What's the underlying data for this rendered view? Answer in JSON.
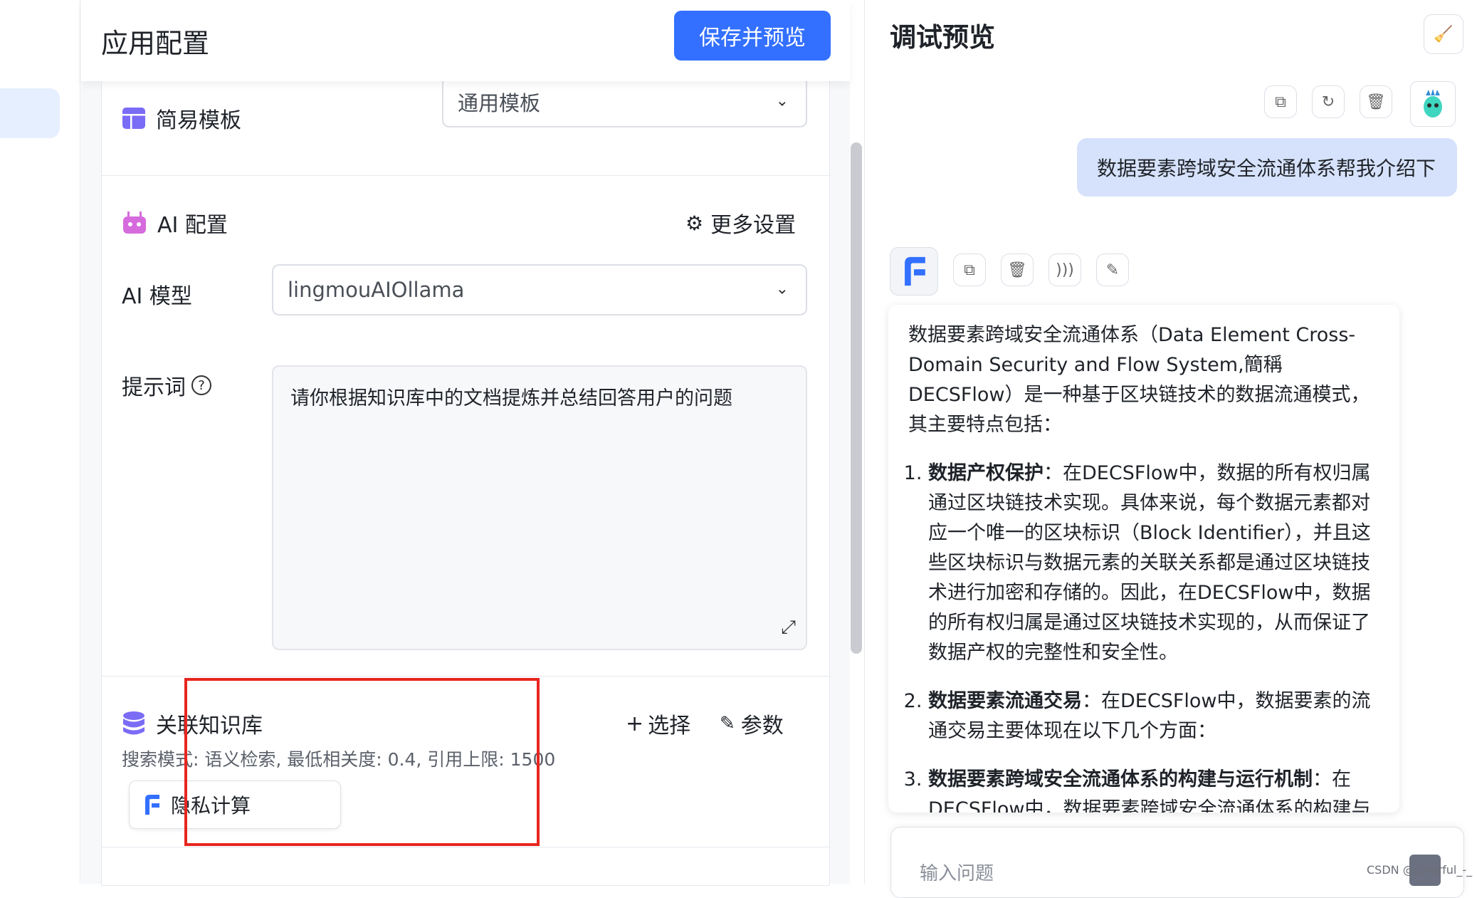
{
  "config": {
    "title": "应用配置",
    "save_button": "保存并预览",
    "template": {
      "label": "简易模板",
      "selected": "通用模板"
    },
    "ai": {
      "section_label": "AI 配置",
      "more_settings": "更多设置",
      "model_label": "AI 模型",
      "model_value": "lingmouAIOllama",
      "prompt_label": "提示词",
      "prompt_value": "请你根据知识库中的文档提炼并总结回答用户的问题"
    },
    "knowledge": {
      "label": "关联知识库",
      "select_button": "选择",
      "params_button": "参数",
      "search_info": "搜索模式: 语义检索, 最低相关度: 0.4, 引用上限: 1500",
      "tag": "隐私计算"
    }
  },
  "debug": {
    "title": "调试预览",
    "user_message": "数据要素跨域安全流通体系帮我介绍下",
    "bot": {
      "intro": "数据要素跨域安全流通体系（Data Element Cross-Domain Security and Flow System,簡稱DECSFlow）是一种基于区块链技术的数据流通模式，其主要特点包括：",
      "items": [
        {
          "title": "数据产权保护",
          "text": "：在DECSFlow中，数据的所有权归属通过区块链技术实现。具体来说，每个数据元素都对应一个唯一的区块标识（Block Identifier），并且这些区块标识与数据元素的关联关系都是通过区块链技术进行加密和存储的。因此，在DECSFlow中，数据的所有权归属是通过区块链技术实现的，从而保证了数据产权的完整性和安全性。"
        },
        {
          "title": "数据要素流通交易",
          "text": "：在DECSFlow中，数据要素的流通交易主要体现在以下几个方面："
        },
        {
          "title": "数据要素跨域安全流通体系的构建与运行机制",
          "text": "：在DECSFlow中，数据要素跨域安全流通体系的构建与"
        }
      ]
    },
    "input_placeholder": "输入问题"
  },
  "watermark": "CSDN @colorful_-_",
  "colors": {
    "primary": "#3370ff",
    "highlight": "#e7261f",
    "user_bubble": "#d6e2fb"
  },
  "icons": [
    "template-icon",
    "robot-icon",
    "gear-icon",
    "database-icon",
    "edit-icon",
    "copy-icon",
    "refresh-icon",
    "trash-icon",
    "speaker-icon",
    "pencil-icon",
    "broom-icon",
    "send-icon"
  ]
}
